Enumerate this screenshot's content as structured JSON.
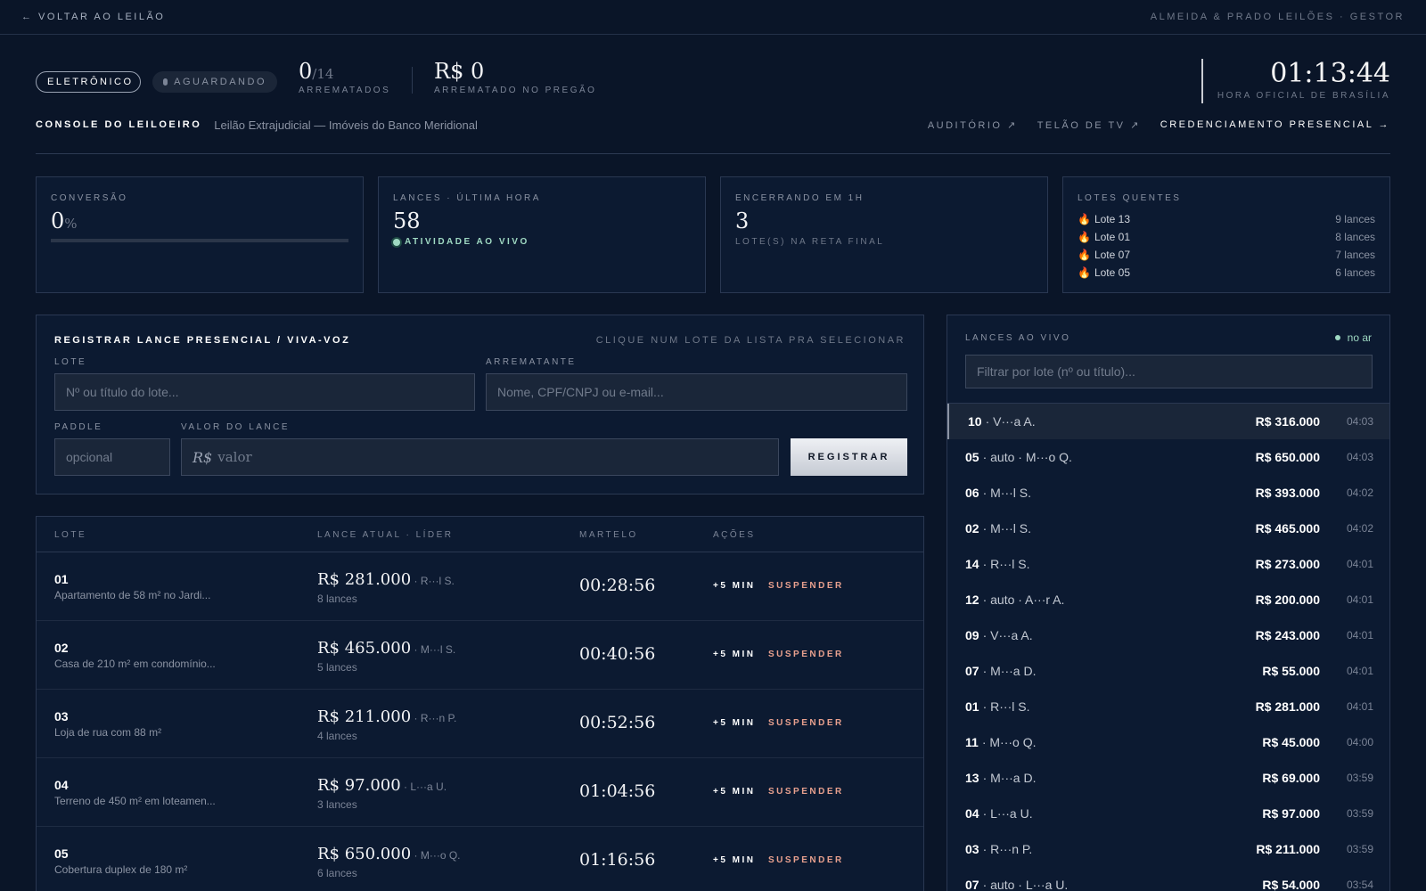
{
  "topbar": {
    "back": "← VOLTAR AO LEILÃO",
    "brand": "ALMEIDA & PRADO LEILÕES · GESTOR"
  },
  "header": {
    "mode_pill": "ELETRÔNICO",
    "status_pill": "AGUARDANDO",
    "sold_count": "0",
    "sold_total": "/14",
    "sold_label": "ARREMATADOS",
    "sold_value": "R$ 0",
    "sold_value_label": "ARREMATADO NO PREGÃO",
    "clock": "01:13:44",
    "clock_label": "HORA OFICIAL DE BRASÍLIA"
  },
  "subheader": {
    "console": "CONSOLE DO LEILOEIRO",
    "event": "Leilão Extrajudicial — Imóveis do Banco Meridional",
    "links": [
      "AUDITÓRIO ↗",
      "TELÃO DE TV ↗",
      "CREDENCIAMENTO PRESENCIAL →"
    ]
  },
  "stats": {
    "conversion": {
      "title": "CONVERSÃO",
      "value": "0",
      "unit": "%",
      "progress": 0
    },
    "bids_hour": {
      "title": "LANCES · ÚLTIMA HORA",
      "value": "58",
      "live": "ATIVIDADE AO VIVO"
    },
    "closing": {
      "title": "ENCERRANDO EM 1H",
      "value": "3",
      "note": "LOTE(S) NA RETA FINAL"
    },
    "hot": {
      "title": "LOTES QUENTES",
      "icon": "flame-icon",
      "items": [
        {
          "name": "Lote 13",
          "count": "9 lances"
        },
        {
          "name": "Lote 01",
          "count": "8 lances"
        },
        {
          "name": "Lote 07",
          "count": "7 lances"
        },
        {
          "name": "Lote 05",
          "count": "6 lances"
        }
      ]
    }
  },
  "form": {
    "title": "REGISTRAR LANCE PRESENCIAL / VIVA-VOZ",
    "hint": "CLIQUE NUM LOTE DA LISTA PRA SELECIONAR",
    "lot_label": "LOTE",
    "lot_placeholder": "Nº ou título do lote...",
    "bidder_label": "ARREMATANTE",
    "bidder_placeholder": "Nome, CPF/CNPJ ou e-mail...",
    "paddle_label": "PADDLE",
    "paddle_placeholder": "opcional",
    "amount_label": "VALOR DO LANCE",
    "currency": "R$",
    "amount_placeholder": "valor",
    "submit": "REGISTRAR"
  },
  "lots_table": {
    "headers": [
      "LOTE",
      "LANCE ATUAL · LÍDER",
      "MARTELO",
      "AÇÕES"
    ],
    "action_extend": "+5 MIN",
    "action_suspend": "SUSPENDER",
    "rows": [
      {
        "num": "01",
        "desc": "Apartamento de 58 m² no Jardi...",
        "bid": "R$ 281.000",
        "leader": " · R···l S.",
        "bids": "8 lances",
        "timer": "00:28:56"
      },
      {
        "num": "02",
        "desc": "Casa de 210 m² em condomínio...",
        "bid": "R$ 465.000",
        "leader": " · M···l S.",
        "bids": "5 lances",
        "timer": "00:40:56"
      },
      {
        "num": "03",
        "desc": "Loja de rua com 88 m²",
        "bid": "R$ 211.000",
        "leader": " · R···n P.",
        "bids": "4 lances",
        "timer": "00:52:56"
      },
      {
        "num": "04",
        "desc": "Terreno de 450 m² em loteamen...",
        "bid": "R$ 97.000",
        "leader": " · L···a U.",
        "bids": "3 lances",
        "timer": "01:04:56"
      },
      {
        "num": "05",
        "desc": "Cobertura duplex de 180 m²",
        "bid": "R$ 650.000",
        "leader": " · M···o Q.",
        "bids": "6 lances",
        "timer": "01:16:56"
      }
    ]
  },
  "live": {
    "title": "LANCES AO VIVO",
    "on_air": "no ar",
    "filter_placeholder": "Filtrar por lote (nº ou título)...",
    "bids": [
      {
        "lot": "10",
        "who": "· V···a A.",
        "amount": "R$ 316.000",
        "time": "04:03",
        "active": true
      },
      {
        "lot": "05",
        "who": "· auto · M···o Q.",
        "amount": "R$ 650.000",
        "time": "04:03"
      },
      {
        "lot": "06",
        "who": "· M···l S.",
        "amount": "R$ 393.000",
        "time": "04:02"
      },
      {
        "lot": "02",
        "who": "· M···l S.",
        "amount": "R$ 465.000",
        "time": "04:02"
      },
      {
        "lot": "14",
        "who": "· R···l S.",
        "amount": "R$ 273.000",
        "time": "04:01"
      },
      {
        "lot": "12",
        "who": "· auto · A···r A.",
        "amount": "R$ 200.000",
        "time": "04:01"
      },
      {
        "lot": "09",
        "who": "· V···a A.",
        "amount": "R$ 243.000",
        "time": "04:01"
      },
      {
        "lot": "07",
        "who": "· M···a D.",
        "amount": "R$ 55.000",
        "time": "04:01"
      },
      {
        "lot": "01",
        "who": "· R···l S.",
        "amount": "R$ 281.000",
        "time": "04:01"
      },
      {
        "lot": "11",
        "who": "· M···o Q.",
        "amount": "R$ 45.000",
        "time": "04:00"
      },
      {
        "lot": "13",
        "who": "· M···a D.",
        "amount": "R$ 69.000",
        "time": "03:59"
      },
      {
        "lot": "04",
        "who": "· L···a U.",
        "amount": "R$ 97.000",
        "time": "03:59"
      },
      {
        "lot": "03",
        "who": "· R···n P.",
        "amount": "R$ 211.000",
        "time": "03:59"
      },
      {
        "lot": "07",
        "who": "· auto · L···a U.",
        "amount": "R$ 54.000",
        "time": "03:54"
      }
    ]
  }
}
